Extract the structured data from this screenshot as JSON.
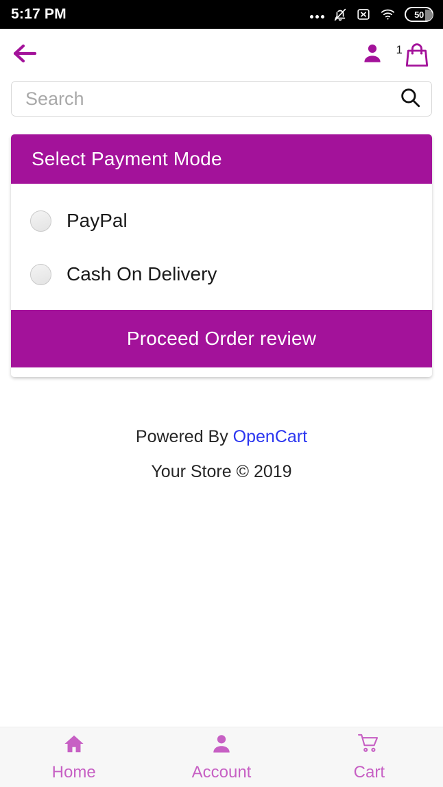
{
  "status_bar": {
    "time": "5:17 PM",
    "icons": [
      "more-dots-icon",
      "bell-muted-icon",
      "no-sim-icon",
      "wifi-icon",
      "battery-icon"
    ],
    "battery_level": "50"
  },
  "app_bar": {
    "back_icon": "back-arrow-icon",
    "account_icon": "user-icon",
    "cart_icon": "shopping-bag-icon",
    "cart_count": "1"
  },
  "search": {
    "placeholder": "Search",
    "value": "",
    "icon": "search-icon"
  },
  "payment_card": {
    "title": "Select Payment Mode",
    "options": [
      {
        "label": "PayPal",
        "selected": false
      },
      {
        "label": "Cash On Delivery",
        "selected": false
      }
    ],
    "proceed_label": "Proceed Order review"
  },
  "footer": {
    "powered_by": "Powered By ",
    "brand": "OpenCart",
    "copyright": "Your Store © 2019"
  },
  "bottom_nav": [
    {
      "label": "Home",
      "icon": "home-icon"
    },
    {
      "label": "Account",
      "icon": "person-icon"
    },
    {
      "label": "Cart",
      "icon": "cart-icon"
    }
  ],
  "colors": {
    "primary": "#A3129A",
    "nav_accent": "#C760C4",
    "link": "#2a35f0"
  }
}
